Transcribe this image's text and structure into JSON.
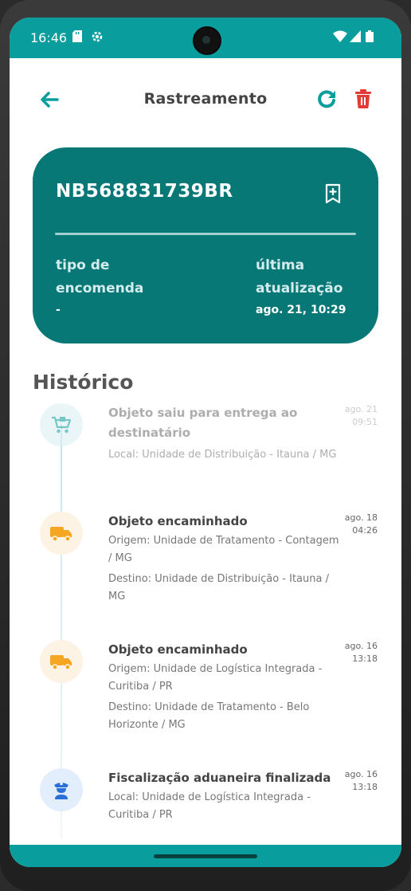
{
  "status": {
    "time": "16:46"
  },
  "header": {
    "title": "Rastreamento"
  },
  "card": {
    "code": "NB568831739BR",
    "type_label": "tipo de encomenda",
    "type_value": "-",
    "update_label": "última atualização",
    "update_value": "ago. 21, 10:29"
  },
  "history": {
    "title": "Histórico",
    "events": [
      {
        "title": "Objeto saiu para entrega ao destinatário",
        "lines": [
          "Local: Unidade de Distribuição - Itauna / MG"
        ],
        "date": "ago. 21",
        "time": "09:51",
        "icon": "cart-icon"
      },
      {
        "title": "Objeto encaminhado",
        "lines": [
          "Origem: Unidade de Tratamento - Contagem / MG",
          "Destino: Unidade de Distribuição - Itauna / MG"
        ],
        "date": "ago. 18",
        "time": "04:26",
        "icon": "truck-icon"
      },
      {
        "title": "Objeto encaminhado",
        "lines": [
          "Origem: Unidade de Logística Integrada - Curitiba / PR",
          "Destino: Unidade de Tratamento - Belo Horizonte / MG"
        ],
        "date": "ago. 16",
        "time": "13:18",
        "icon": "truck-icon"
      },
      {
        "title": "Fiscalização aduaneira finalizada",
        "lines": [
          "Local: Unidade de Logística Integrada - Curitiba / PR"
        ],
        "date": "ago. 16",
        "time": "13:18",
        "icon": "officer-icon"
      }
    ]
  },
  "colors": {
    "accent": "#0a9d9d",
    "card": "#087877",
    "delete": "#e53935",
    "truck": "#f5a623"
  }
}
